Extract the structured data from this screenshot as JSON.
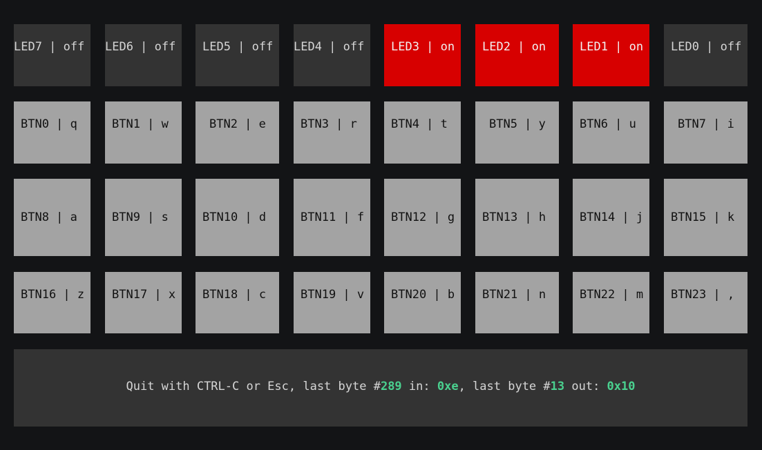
{
  "leds": [
    {
      "label": "LED7 | off",
      "state": "off"
    },
    {
      "label": "LED6 | off",
      "state": "off"
    },
    {
      "label": "LED5 | off",
      "state": "off"
    },
    {
      "label": "LED4 | off",
      "state": "off"
    },
    {
      "label": "LED3 | on",
      "state": "on"
    },
    {
      "label": "LED2 | on",
      "state": "on"
    },
    {
      "label": "LED1 | on",
      "state": "on"
    },
    {
      "label": "LED0 | off",
      "state": "off"
    }
  ],
  "buttons": [
    [
      "BTN0 | q",
      "BTN1 | w",
      "BTN2 | e",
      "BTN3 | r",
      "BTN4 | t",
      "BTN5 | y",
      "BTN6 | u",
      "BTN7 | i"
    ],
    [
      "BTN8 | a",
      "BTN9 | s",
      "BTN10 | d",
      "BTN11 | f",
      "BTN12 | g",
      "BTN13 | h",
      "BTN14 | j",
      "BTN15 | k"
    ],
    [
      "BTN16 | z",
      "BTN17 | x",
      "BTN18 | c",
      "BTN19 | v",
      "BTN20 | b",
      "BTN21 | n",
      "BTN22 | m",
      "BTN23 | ,"
    ]
  ],
  "status": {
    "prefix": "Quit with CTRL-C or Esc, last byte #",
    "in_count": "289",
    "in_label": " in: ",
    "in_value": "0xe",
    "mid": ", last byte #",
    "out_count": "13",
    "out_label": " out: ",
    "out_value": "0x10"
  },
  "colors": {
    "background": "#131416",
    "led_off": "#333333",
    "led_on": "#d70000",
    "button": "#a3a3a3",
    "highlight": "#4ad18f"
  }
}
